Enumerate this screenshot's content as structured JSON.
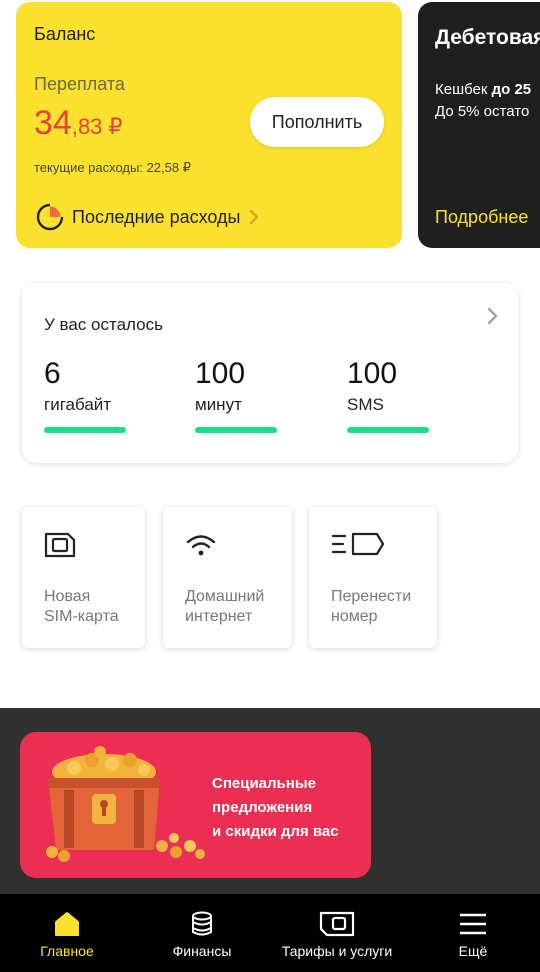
{
  "balance": {
    "title": "Баланс",
    "overpay_label": "Переплата",
    "amount_int": "34",
    "amount_dec": ",83 ₽",
    "current_expenses": "текущие расходы: 22,58 ₽",
    "last_expenses": "Последние расходы",
    "topup_button": "Пополнить",
    "accent_color": "#fce22e",
    "amount_color": "#e8413c"
  },
  "debit": {
    "title": "Дебетовая",
    "line1_prefix": "Кешбек ",
    "line1_bold": "до 25",
    "line2": "До 5% остато",
    "more": "Подробнее"
  },
  "remaining": {
    "title": "У вас осталось",
    "stats": [
      {
        "value": "6",
        "unit": "гигабайт",
        "fill": 1.0
      },
      {
        "value": "100",
        "unit": "минут",
        "fill": 1.0
      },
      {
        "value": "100",
        "unit": "SMS",
        "fill": 1.0
      }
    ],
    "bar_color": "#1edc85"
  },
  "actions": [
    {
      "label": "Новая\nSIM-карта",
      "icon": "sim-card-icon"
    },
    {
      "label": "Домашний\nинтернет",
      "icon": "wifi-icon"
    },
    {
      "label": "Перенести\nномер",
      "icon": "transfer-number-icon"
    }
  ],
  "promo": {
    "text": "Специальные\nпредложения\nи скидки для вас",
    "color": "#ea2e54"
  },
  "nav": [
    {
      "label": "Главное",
      "icon": "home-icon",
      "active": true
    },
    {
      "label": "Финансы",
      "icon": "coins-icon",
      "active": false
    },
    {
      "label": "Тарифы и услуги",
      "icon": "sim-icon",
      "active": false
    },
    {
      "label": "Ещё",
      "icon": "menu-icon",
      "active": false
    }
  ]
}
